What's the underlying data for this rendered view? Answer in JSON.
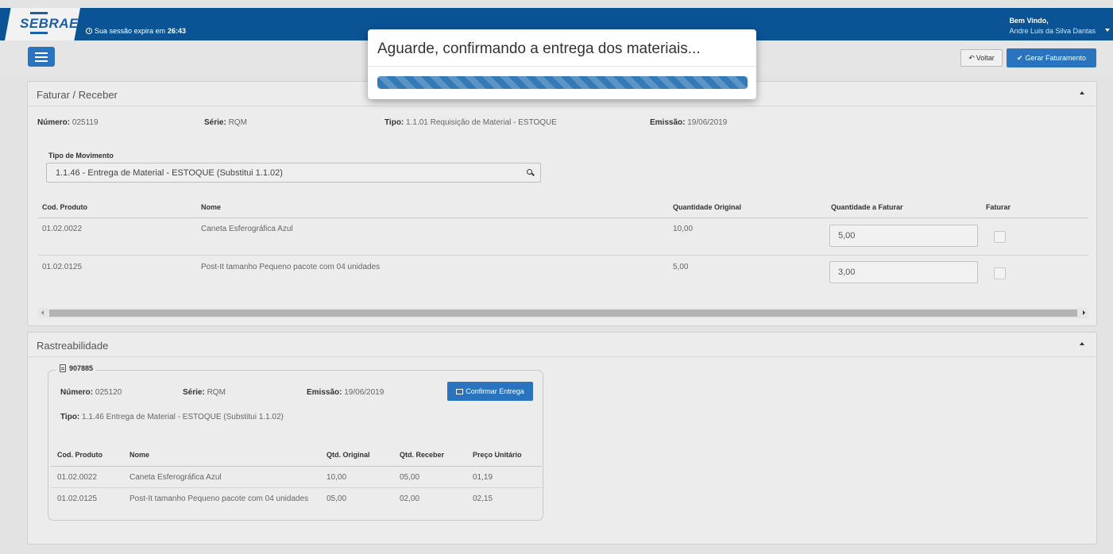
{
  "header": {
    "logo_text": "SEBRAE",
    "session_prefix": "Sua sessão expira em",
    "session_time": "26:43",
    "welcome": "Bem Vindo,",
    "user_name": "Andre Luis da Silva Dantas"
  },
  "toolbar": {
    "back_label": "Voltar",
    "generate_label": "Gerar Faturamento"
  },
  "faturar_panel": {
    "title": "Faturar / Receber",
    "numero_label": "Número:",
    "numero": "025119",
    "serie_label": "Série:",
    "serie": "RQM",
    "tipo_label": "Tipo:",
    "tipo": "1.1.01 Requisição de Material - ESTOQUE",
    "emissao_label": "Emissão:",
    "emissao": "19/06/2019",
    "tipo_movimento_label": "Tipo de Movimento",
    "tipo_movimento_value": "1.1.46 - Entrega de Material - ESTOQUE (Substitui 1.1.02)",
    "columns": [
      "Cod. Produto",
      "Nome",
      "Quantidade Original",
      "Quantidade a Faturar",
      "Faturar"
    ],
    "rows": [
      {
        "cod": "01.02.0022",
        "nome": "Caneta Esferográfica Azul",
        "qtd_original": "10,00",
        "qtd_faturar": "5,00"
      },
      {
        "cod": "01.02.0125",
        "nome": "Post-It tamanho Pequeno pacote com 04 unidades",
        "qtd_original": "5,00",
        "qtd_faturar": "3,00"
      }
    ]
  },
  "rastreabilidade_panel": {
    "title": "Rastreabilidade",
    "doc_number": "907885",
    "numero_label": "Número:",
    "numero": "025120",
    "serie_label": "Série:",
    "serie": "RQM",
    "emissao_label": "Emissão:",
    "emissao": "19/06/2019",
    "tipo_label": "Tipo:",
    "tipo": "1.1.46 Entrega de Material - ESTOQUE (Substitui 1.1.02)",
    "confirm_label": "Confirmar Entrega",
    "columns": [
      "Cod. Produto",
      "Nome",
      "Qtd. Original",
      "Qtd. Receber",
      "Preço Unitário"
    ],
    "rows": [
      {
        "cod": "01.02.0022",
        "nome": "Caneta Esferográfica Azul",
        "qtd_original": "10,00",
        "qtd_receber": "05,00",
        "preco": "01,19"
      },
      {
        "cod": "01.02.0125",
        "nome": "Post-It tamanho Pequeno pacote com 04 unidades",
        "qtd_original": "05,00",
        "qtd_receber": "02,00",
        "preco": "02,15"
      }
    ]
  },
  "modal": {
    "message": "Aguarde, confirmando a entrega dos materiais..."
  },
  "colors": {
    "header_bg": "#0a5394",
    "primary": "#2a73bf",
    "progress": "#337ab7"
  },
  "icons": [
    "clock-icon",
    "caret-down-icon",
    "hamburger-menu-icon",
    "reply-icon",
    "check-icon",
    "chevron-up-icon",
    "search-icon",
    "document-icon",
    "envelope-icon"
  ]
}
